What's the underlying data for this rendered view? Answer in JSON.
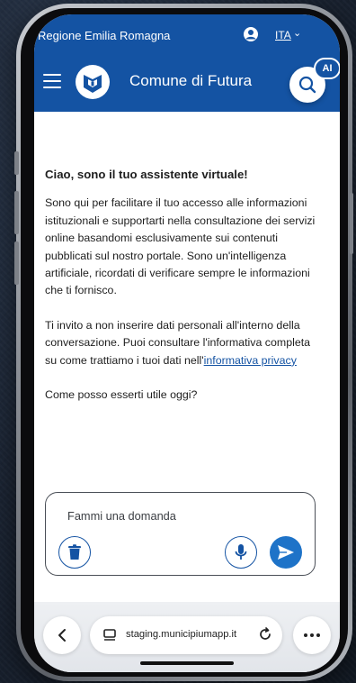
{
  "status_bar": {
    "region": "Regione Emilia Romagna",
    "language": "ITA"
  },
  "header": {
    "site_title": "Comune di Futura",
    "ai_badge": "AI"
  },
  "assistant": {
    "greeting": "Ciao, sono il tuo assistente virtuale!",
    "intro": "Sono qui per facilitare il tuo accesso alle informazioni istituzionali e supportarti nella consultazione dei servizi online basandomi esclusivamente sui contenuti pubblicati sul nostro portale. Sono un'intelligenza artificiale, ricordati di verificare sempre le informazioni che ti fornisco.",
    "privacy_text": "Ti invito a non inserire dati personali all'interno della conversazione. Puoi consultare l'informativa completa su come trattiamo i tuoi dati nell'",
    "privacy_link": "informativa privacy",
    "question": "Come posso esserti utile oggi?"
  },
  "chat_input": {
    "placeholder": "Fammi una domanda"
  },
  "browser": {
    "url": "staging.municipiumapp.it"
  },
  "colors": {
    "brand_blue": "#1453a3",
    "send_blue": "#1e73c8"
  },
  "icons": [
    "hamburger-menu-icon",
    "user-icon",
    "chevron-down-icon",
    "search-icon",
    "trash-icon",
    "microphone-icon",
    "send-icon",
    "back-icon",
    "page-icon",
    "reload-icon",
    "more-icon"
  ]
}
